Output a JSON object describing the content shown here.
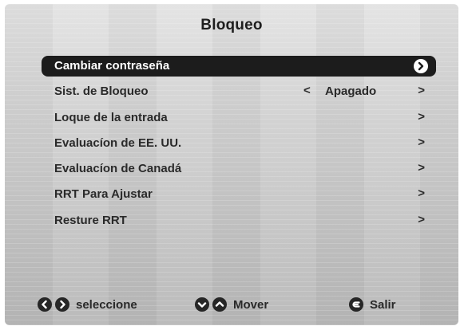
{
  "title": "Bloqueo",
  "menu": {
    "items": [
      {
        "label": "Cambiar contraseña",
        "value": "",
        "selected": true
      },
      {
        "label": "Sist. de Bloqueo",
        "value": "Apagado",
        "selected": false
      },
      {
        "label": "Loque de la entrada",
        "value": "",
        "selected": false
      },
      {
        "label": "Evaluacíon de EE. UU.",
        "value": "",
        "selected": false
      },
      {
        "label": "Evaluacíon de Canadá",
        "value": "",
        "selected": false
      },
      {
        "label": "RRT Para Ajustar",
        "value": "",
        "selected": false
      },
      {
        "label": "Resture RRT",
        "value": "",
        "selected": false
      }
    ],
    "left_arrow_glyph": "<",
    "right_arrow_glyph": ">"
  },
  "footer": {
    "select_label": "seleccione",
    "move_label": "Mover",
    "exit_label": "Salir"
  },
  "icons": {
    "select_left": "chevron-left-icon",
    "select_right": "chevron-right-icon",
    "move_down": "chevron-down-icon",
    "move_up": "chevron-up-icon",
    "exit": "exit-icon"
  },
  "colors": {
    "highlight": "#1c1c1c",
    "text": "#2a2a2a",
    "background": "#cfcfcf"
  }
}
